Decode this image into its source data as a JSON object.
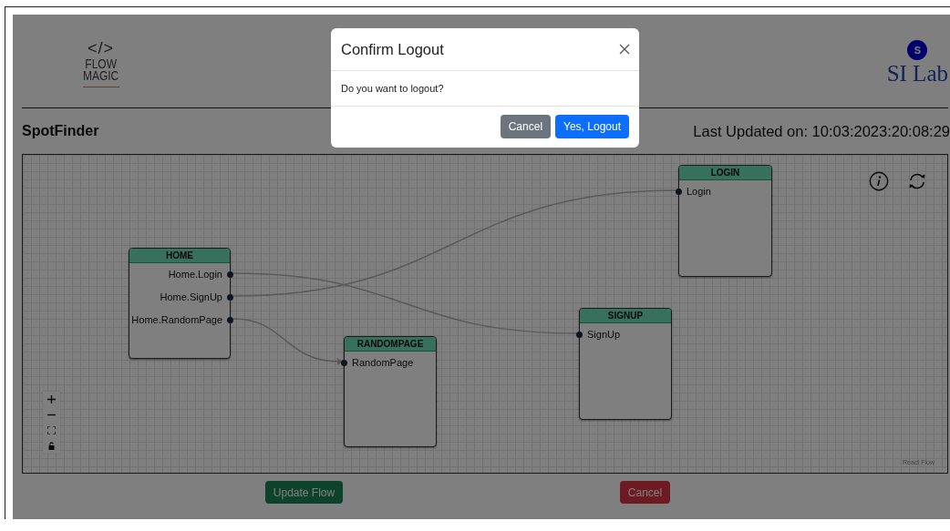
{
  "header": {
    "logo": {
      "symbol": "</>",
      "lines": [
        "FLOW",
        "MAGIC"
      ]
    },
    "avatar_initial": "S",
    "lab_name": "SI Lab"
  },
  "project": {
    "name": "SpotFinder",
    "last_updated": "Last Updated on: 10:03:2023:20:08:29"
  },
  "flow": {
    "nodes": [
      {
        "title": "HOME",
        "kind": "source",
        "ports": [
          "Home.Login",
          "Home.SignUp",
          "Home.RandomPage"
        ]
      },
      {
        "title": "RANDOMPAGE",
        "kind": "target",
        "ports": [
          "RandomPage"
        ]
      },
      {
        "title": "LOGIN",
        "kind": "target",
        "ports": [
          "Login"
        ]
      },
      {
        "title": "SIGNUP",
        "kind": "target",
        "ports": [
          "SignUp"
        ]
      }
    ],
    "attribution": "React Flow"
  },
  "buttons": [
    {
      "label": "Update Flow",
      "kind": "success"
    },
    {
      "label": "Cancel",
      "kind": "danger"
    }
  ],
  "modal": {
    "title": "Confirm Logout",
    "message": "Do you want to logout?",
    "buttons": [
      {
        "label": "Cancel",
        "kind": "secondary"
      },
      {
        "label": "Yes, Logout",
        "kind": "primary"
      }
    ]
  }
}
